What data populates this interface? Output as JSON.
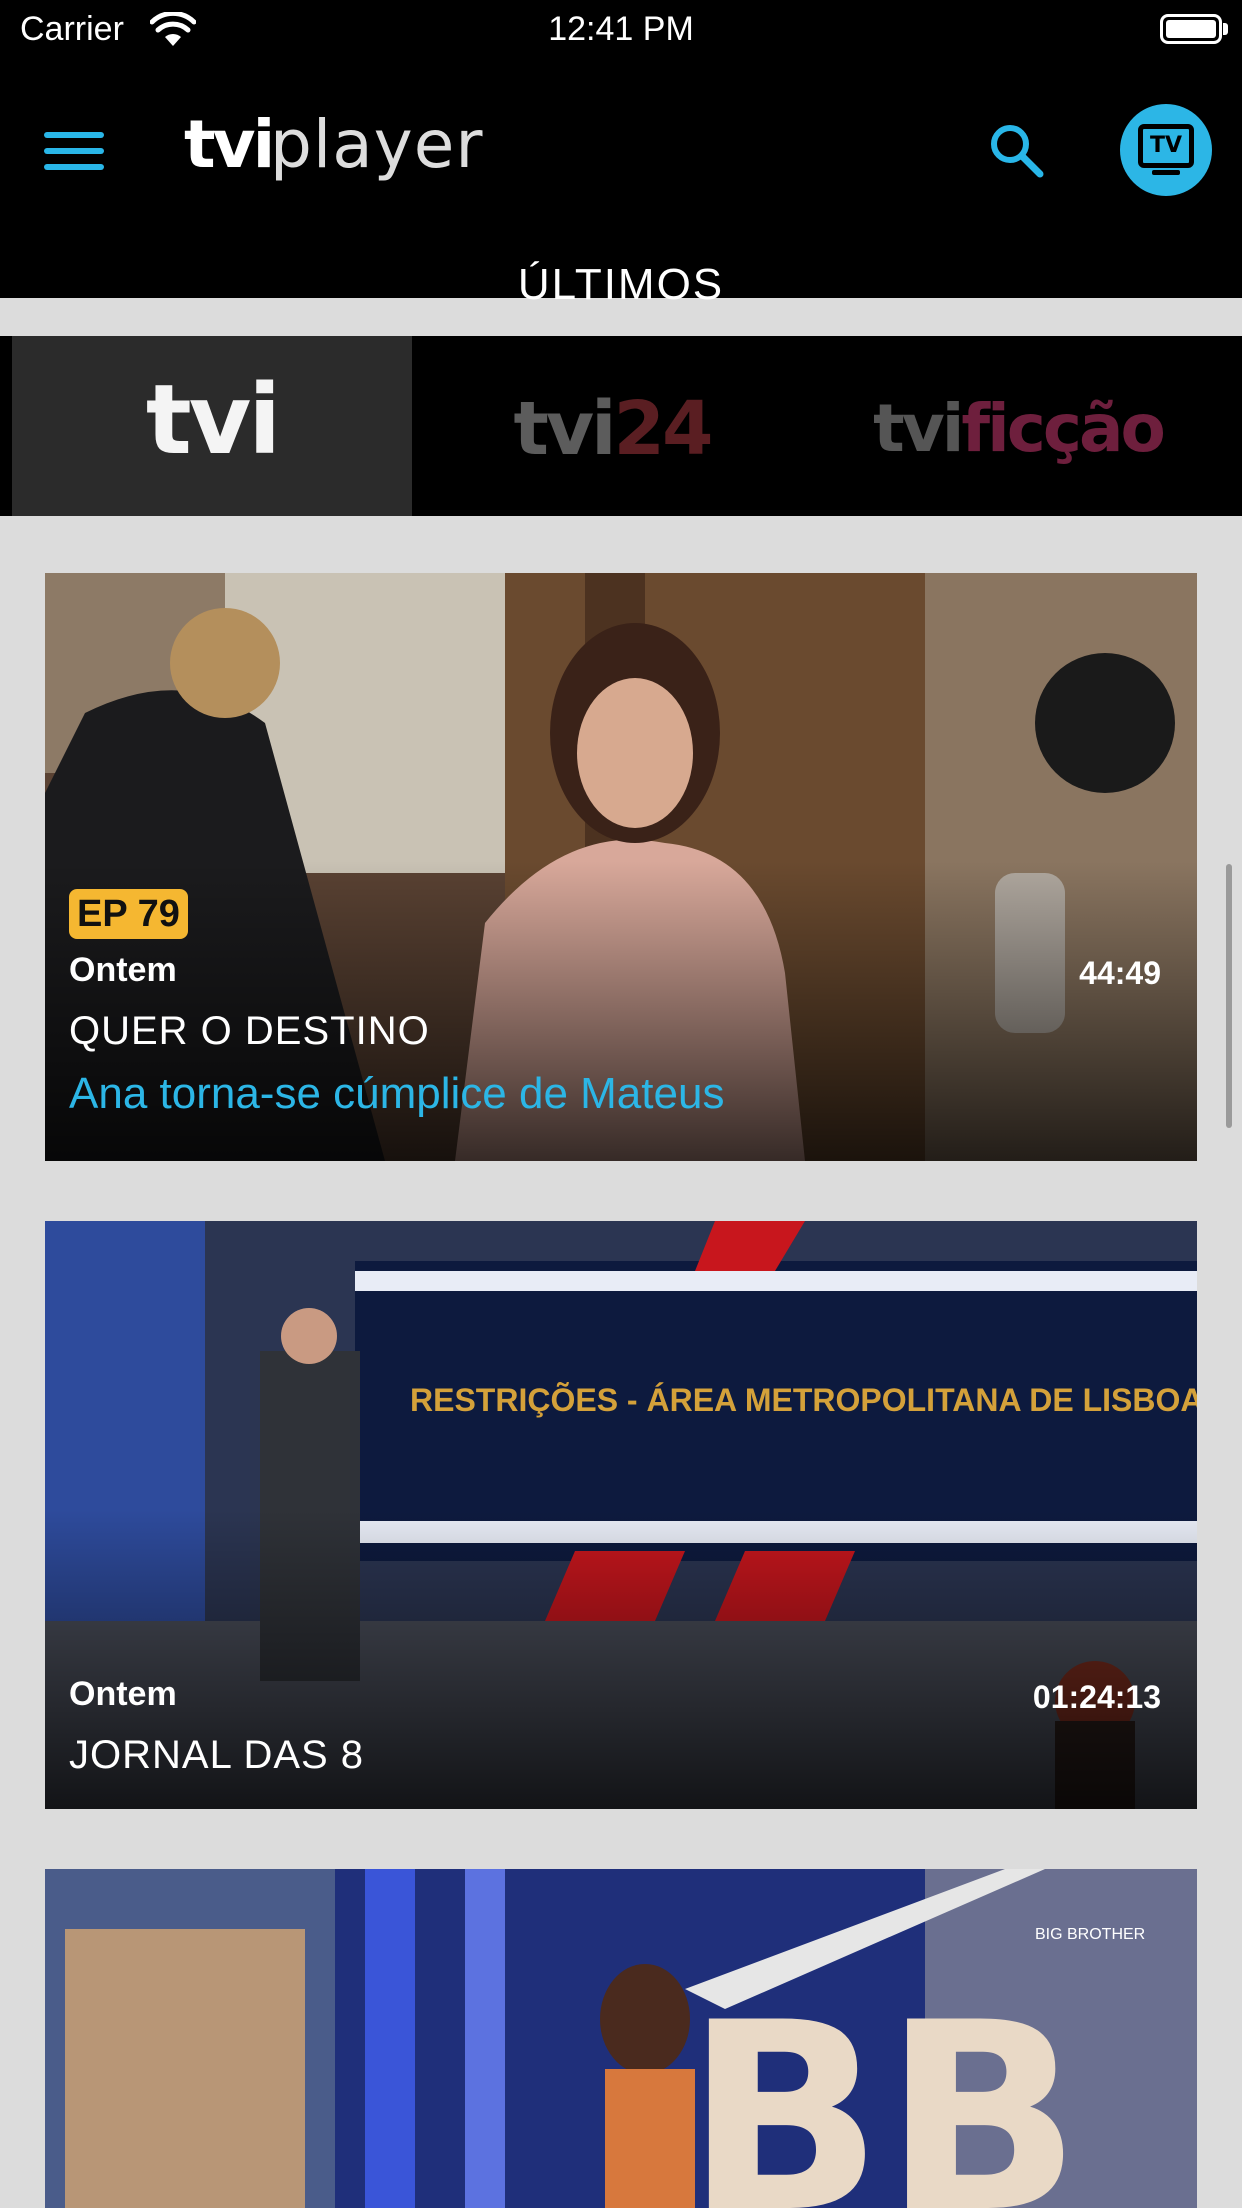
{
  "status_bar": {
    "carrier": "Carrier",
    "time": "12:41 PM"
  },
  "header": {
    "logo_tvi": "tvi",
    "logo_player": "player",
    "section_title": "ÚLTIMOS"
  },
  "channel_tabs": [
    {
      "logo": "tvi",
      "active": true
    },
    {
      "logo_prefix": "tvi",
      "logo_suffix": "24",
      "active": false
    },
    {
      "logo_prefix": "tvi",
      "logo_suffix": "ficção",
      "active": false
    }
  ],
  "tv_button": {
    "label": "TV"
  },
  "cards": [
    {
      "badge": "EP 79",
      "date": "Ontem",
      "duration": "44:49",
      "program": "QUER O DESTINO",
      "episode_title": "Ana torna-se cúmplice de Mateus"
    },
    {
      "date": "Ontem",
      "duration": "01:24:13",
      "program": "JORNAL DAS 8",
      "overlay_text": "RESTRIÇÕES - ÁREA METROPOLITANA DE LISBOA"
    },
    {
      "overlay_text": "BIG BROTHER"
    }
  ],
  "colors": {
    "accent": "#2cb6e6",
    "badge": "#f5b731",
    "background": "#dcdcdc",
    "header": "#000000"
  }
}
